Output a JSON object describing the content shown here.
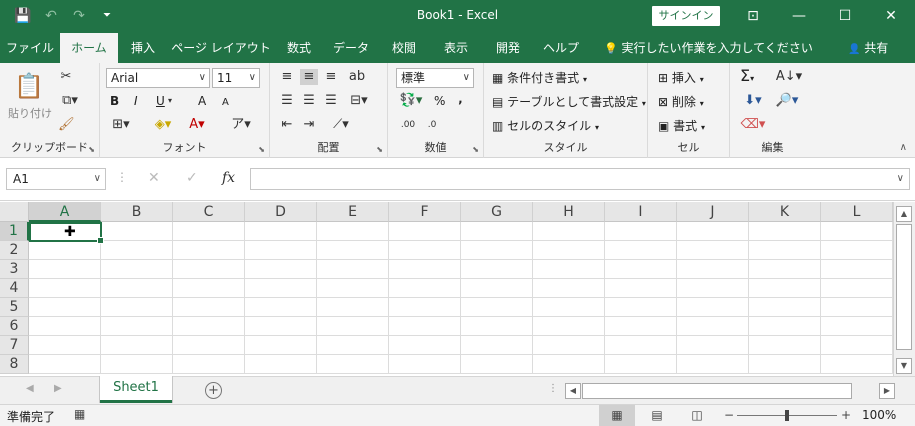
{
  "app": {
    "title": "Book1  -  Excel",
    "signin": "サインイン"
  },
  "qat": {
    "save_icon": "💾",
    "undo_icon": "↶",
    "redo_icon": "↷",
    "customize_icon": "⏷"
  },
  "window": {
    "ribbon_display_icon": "⊡",
    "minimize_icon": "—",
    "maximize_icon": "☐",
    "close_icon": "✕"
  },
  "tabs": [
    "ファイル",
    "ホーム",
    "挿入",
    "ページ レイアウト",
    "数式",
    "データ",
    "校閲",
    "表示",
    "開発",
    "ヘルプ"
  ],
  "tellme": {
    "icon": "💡",
    "label": "実行したい作業を入力してください"
  },
  "share": {
    "icon": "👤",
    "label": "共有"
  },
  "ribbon": {
    "clipboard": {
      "paste": "貼り付け",
      "label": "クリップボード"
    },
    "font": {
      "family": "Arial",
      "size": "11",
      "bold": "B",
      "italic": "I",
      "underline": "U",
      "grow": "A",
      "shrink": "A",
      "label": "フォント"
    },
    "alignment": {
      "label": "配置"
    },
    "number": {
      "format": "標準",
      "percent": "%",
      "comma": "‚",
      "label": "数値"
    },
    "styles": {
      "conditional": "条件付き書式",
      "table": "テーブルとして書式設定",
      "cell": "セルのスタイル",
      "label": "スタイル"
    },
    "cells": {
      "insert": "挿入",
      "delete": "削除",
      "format": "書式",
      "label": "セル"
    },
    "editing": {
      "sum_icon": "Σ",
      "label": "編集"
    }
  },
  "formula_bar": {
    "name_box": "A1",
    "fx": "fx",
    "cancel_icon": "✕",
    "enter_icon": "✓",
    "value": ""
  },
  "grid": {
    "columns": [
      "A",
      "B",
      "C",
      "D",
      "E",
      "F",
      "G",
      "H",
      "I",
      "J",
      "K",
      "L"
    ],
    "rows": [
      "1",
      "2",
      "3",
      "4",
      "5",
      "6",
      "7",
      "8"
    ],
    "active_cell": "A1"
  },
  "sheets": {
    "tabs": [
      "Sheet1"
    ],
    "add_icon": "+"
  },
  "status": {
    "ready": "準備完了",
    "zoom": "100%"
  }
}
